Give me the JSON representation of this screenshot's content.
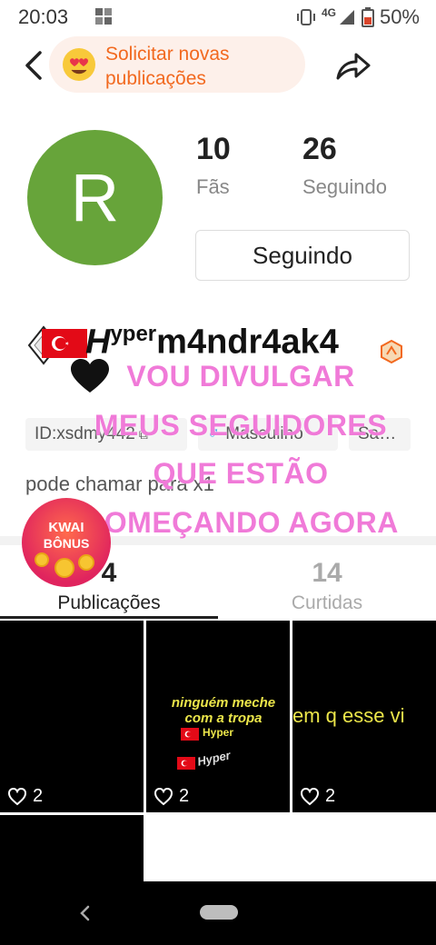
{
  "status_bar": {
    "time": "20:03",
    "network": "4G",
    "battery": "50%"
  },
  "header": {
    "request_label_line1": "Solicitar novas",
    "request_label_line2": "publicações"
  },
  "profile": {
    "avatar_letter": "R",
    "fans_count": "10",
    "fans_label": "Fãs",
    "following_count": "26",
    "following_label": "Seguindo",
    "follow_button_label": "Seguindo",
    "nickname_prefix": "H",
    "nickname_sup": "yper",
    "nickname_main": "m4ndr4ak4",
    "chips": [
      "ID:xsdmy442",
      "Masculino",
      "Sa…"
    ],
    "bio": "pode chamar para x1"
  },
  "overlay_text": [
    "VOU DIVULGAR",
    "MEUS SEGUIDORES",
    "QUE ESTÃO",
    "COMEÇANDO AGORA"
  ],
  "kwai_badge": {
    "line1": "KWAI",
    "line2": "BÔNUS"
  },
  "tabs": [
    {
      "count": "4",
      "label": "Publicações"
    },
    {
      "count": "14",
      "label": "Curtidas"
    }
  ],
  "videos": [
    {
      "likes": "2",
      "caption": ""
    },
    {
      "likes": "2",
      "caption_lines": [
        "ninguém meche",
        "com a tropa"
      ],
      "tag1": "Hyper",
      "tag2": "Hyper"
    },
    {
      "likes": "2",
      "caption": "em q esse vi"
    },
    {
      "likes": "",
      "caption": ""
    }
  ],
  "colors": {
    "accent": "#f2691f",
    "avatar": "#67a43a",
    "overlay": "#f07ad8",
    "caption_yellow": "#ece64a"
  }
}
